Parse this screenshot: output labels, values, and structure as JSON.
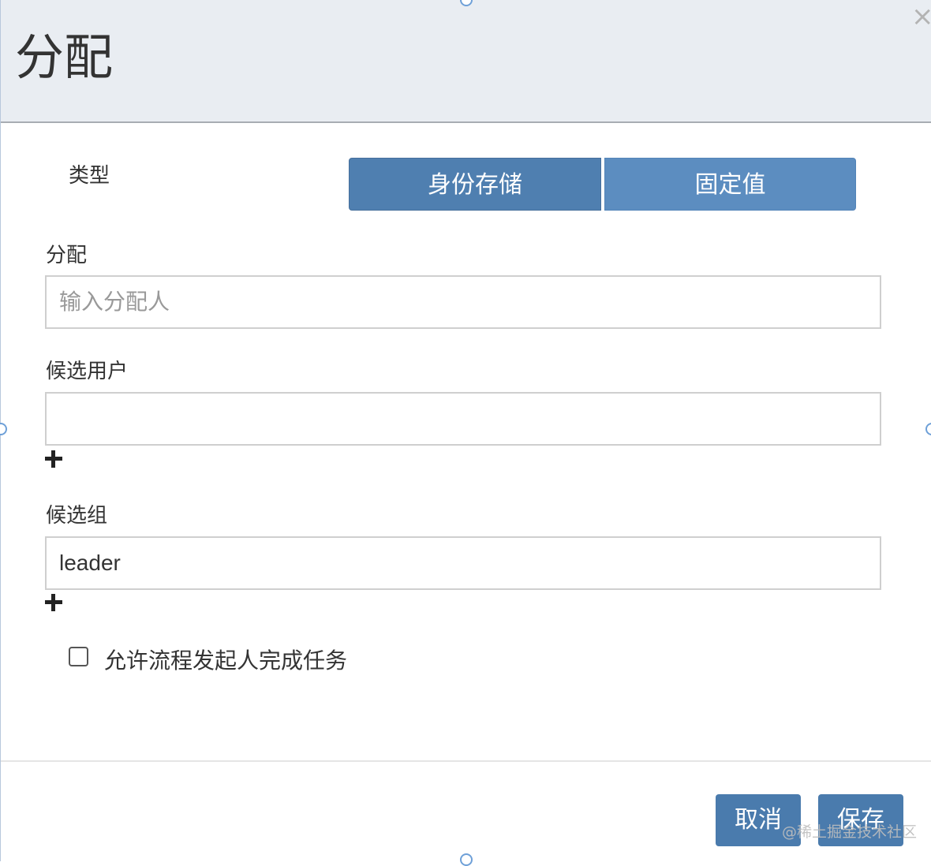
{
  "dialog": {
    "title": "分配",
    "close_icon": "close-icon"
  },
  "type_section": {
    "label": "类型",
    "options": [
      {
        "label": "身份存储",
        "selected": true
      },
      {
        "label": "固定值",
        "selected": false
      }
    ]
  },
  "assignment": {
    "label": "分配",
    "placeholder": "输入分配人",
    "value": ""
  },
  "candidate_users": {
    "label": "候选用户",
    "value": "",
    "add_icon": "plus-icon"
  },
  "candidate_groups": {
    "label": "候选组",
    "value": "leader",
    "add_icon": "plus-icon"
  },
  "initiator_checkbox": {
    "label": "允许流程发起人完成任务",
    "checked": false
  },
  "footer": {
    "cancel_label": "取消",
    "save_label": "保存"
  },
  "watermark": "@稀土掘金技术社区",
  "colors": {
    "header_bg": "#e9edf2",
    "primary_button": "#4a7bad",
    "segment_selected": "#4f7fb0",
    "segment_unselected": "#5c8dc0"
  }
}
